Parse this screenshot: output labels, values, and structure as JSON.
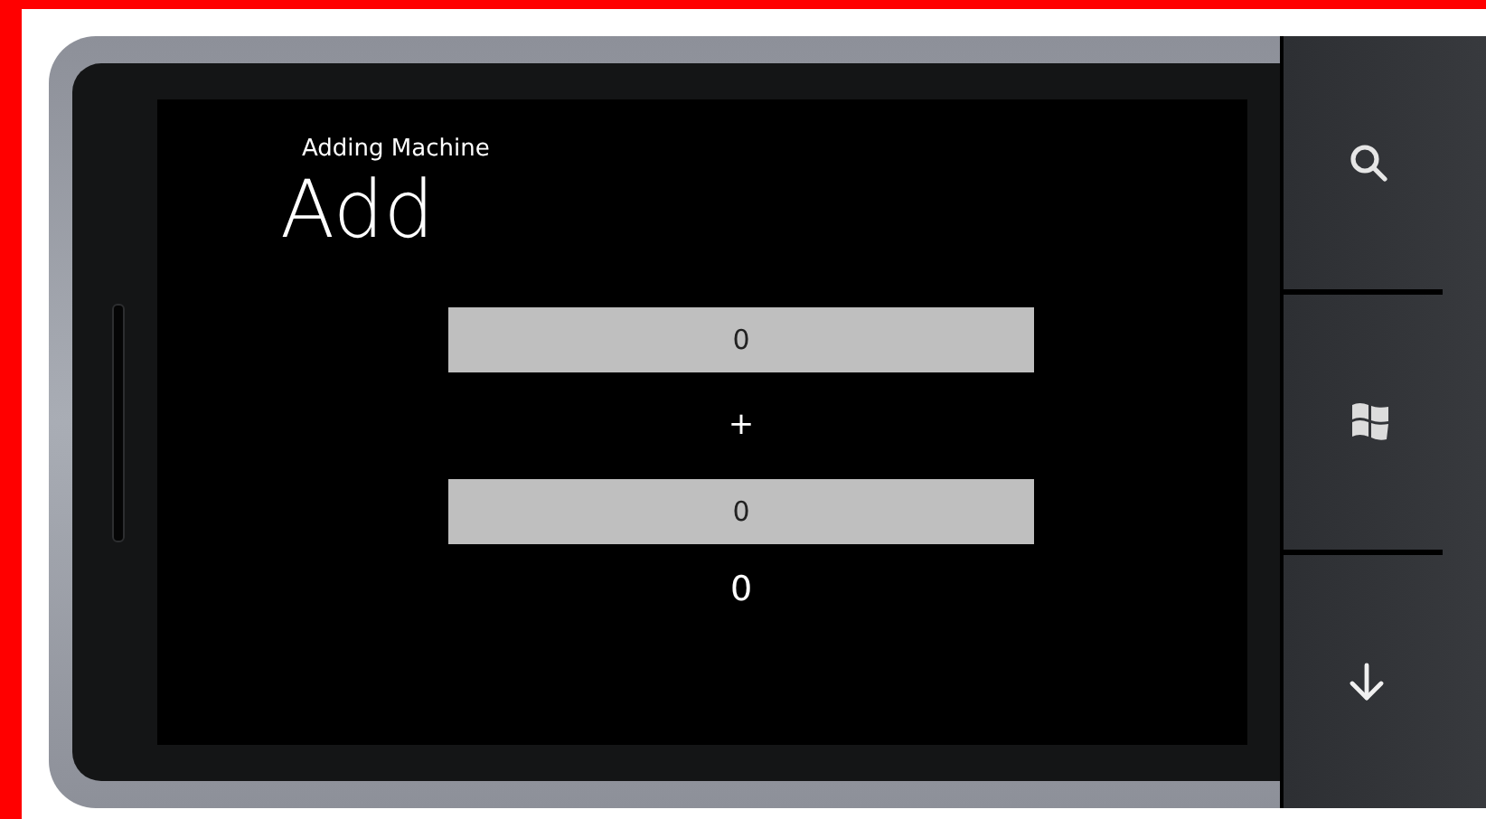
{
  "app_title": "Adding Machine",
  "page_title": "Add",
  "first_number": {
    "value": "0"
  },
  "operator": "+",
  "second_number": {
    "value": "0"
  },
  "result": "0"
}
